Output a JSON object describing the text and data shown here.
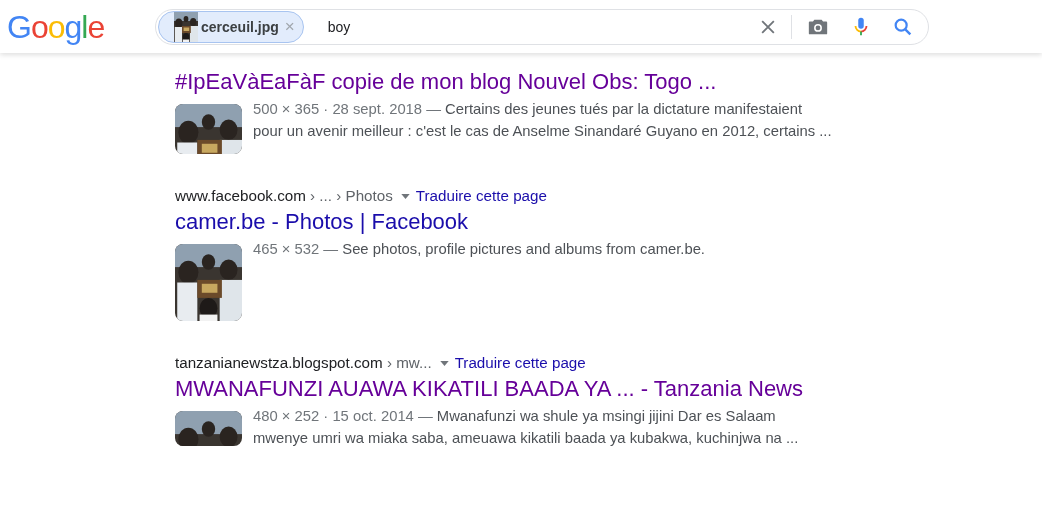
{
  "header": {
    "logo": "Google",
    "search": {
      "chip": {
        "label": "cerceuil.jpg",
        "remove": "×"
      },
      "value": "boy"
    }
  },
  "results": [
    {
      "title": "#IpEaVàEaFàF copie de mon blog Nouvel Obs: Togo ...",
      "visited": true,
      "meta": "500 × 365 · 28 sept. 2018 — ",
      "snippet": "Certains des jeunes tués par la dictature manifestaient pour un avenir meilleur : c'est le cas de Anselme Sinandaré Guyano en 2012, certains ..."
    },
    {
      "url": {
        "site": "www.facebook.com",
        "path": " › ... › Photos",
        "translate": "Traduire cette page"
      },
      "title": "camer.be - Photos | Facebook",
      "visited": false,
      "meta": "465 × 532 — ",
      "snippet": "See photos, profile pictures and albums from camer.be."
    },
    {
      "url": {
        "site": "tanzanianewstza.blogspot.com",
        "path": " › mw...",
        "translate": "Traduire cette page"
      },
      "title": "MWANAFUNZI AUAWA KIKATILI BAADA YA ... - Tanzania News",
      "visited": true,
      "meta": "480 × 252 · 15 oct. 2014 — ",
      "snippet": "Mwanafunzi wa shule ya msingi jijini Dar es Salaam mwenye umri wa miaka saba, ameuawa kikatili baada ya kubakwa, kuchinjwa na ..."
    }
  ]
}
